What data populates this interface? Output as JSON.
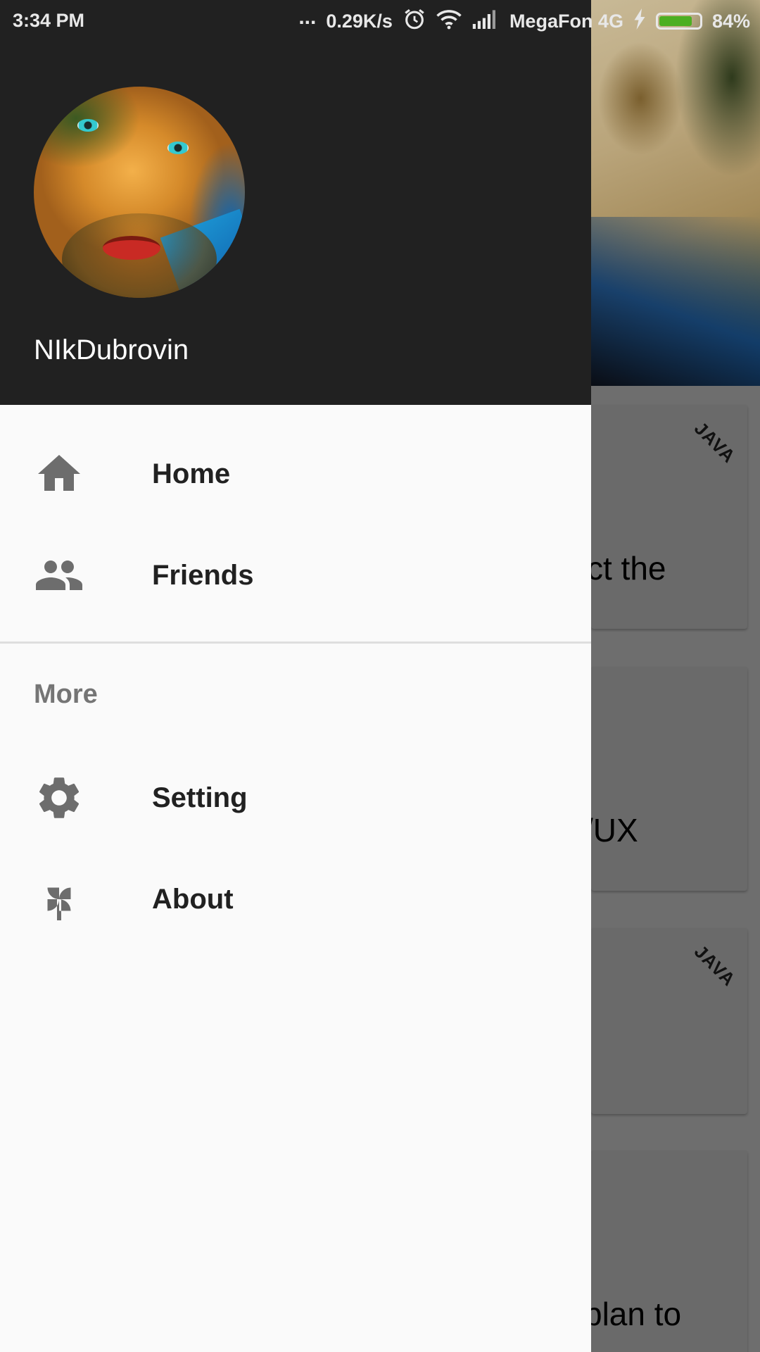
{
  "status_bar": {
    "time": "3:34 PM",
    "more_dots": "...",
    "speed": "0.29K/s",
    "carrier": "MegaFon 4G",
    "battery_percent": "84%",
    "battery_level": 0.84,
    "battery_color": "#4caf22",
    "icons": [
      "alarm-icon",
      "wifi-icon",
      "signal-icon",
      "charging-icon",
      "battery-icon"
    ]
  },
  "drawer": {
    "header_color": "#212121",
    "username": "NIkDubrovin",
    "primary_items": [
      {
        "label": "Home",
        "icon": "home-icon"
      },
      {
        "label": "Friends",
        "icon": "people-icon"
      }
    ],
    "section_title": "More",
    "secondary_items": [
      {
        "label": "Setting",
        "icon": "gear-icon"
      },
      {
        "label": "About",
        "icon": "pinwheel-icon"
      }
    ]
  },
  "background": {
    "cards": [
      {
        "text": "ct the",
        "tag": "JAVA"
      },
      {
        "text": "/UX",
        "tag": ""
      },
      {
        "text": "",
        "tag": "JAVA"
      },
      {
        "text": "plan to",
        "tag": ""
      }
    ]
  }
}
